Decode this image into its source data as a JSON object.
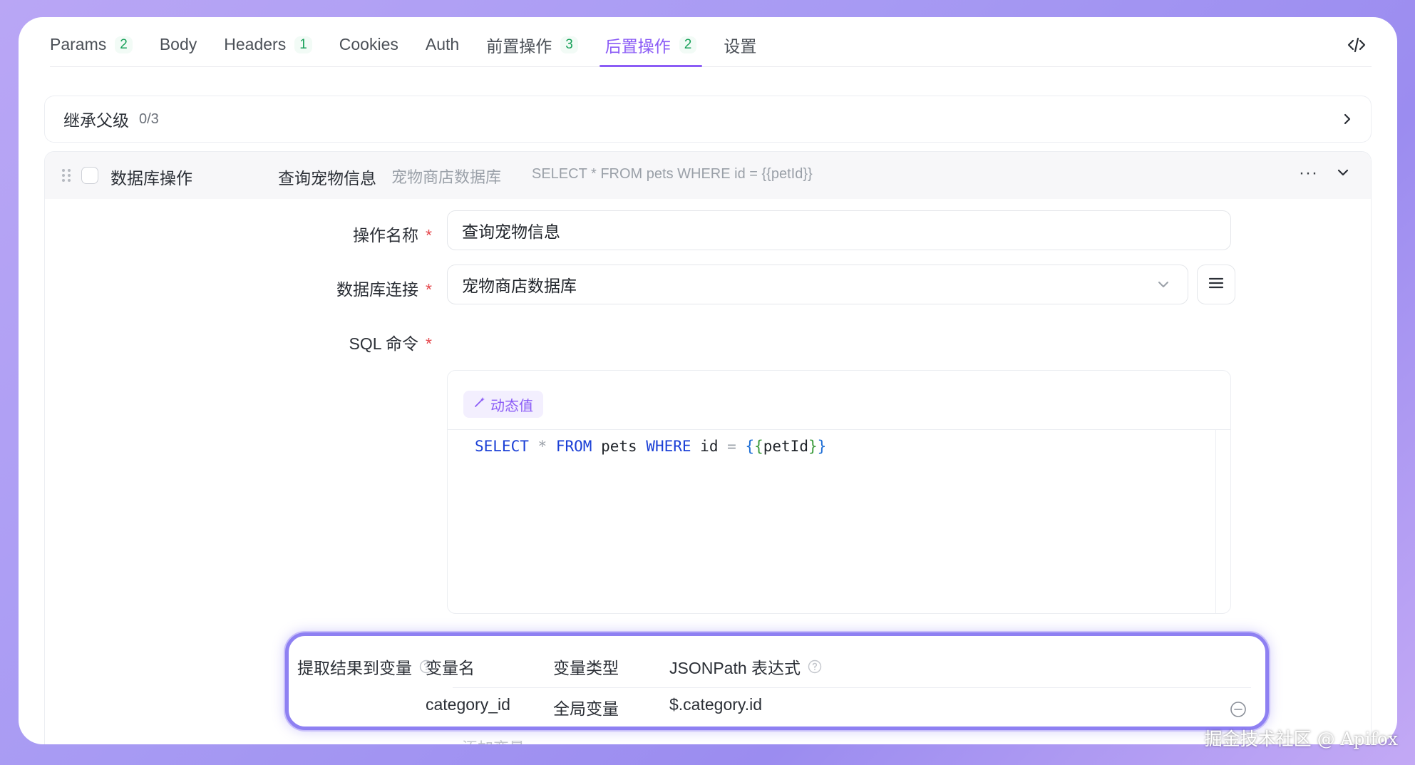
{
  "tabs": [
    {
      "label": "Params",
      "badge": "2"
    },
    {
      "label": "Body",
      "badge": ""
    },
    {
      "label": "Headers",
      "badge": "1"
    },
    {
      "label": "Cookies",
      "badge": ""
    },
    {
      "label": "Auth",
      "badge": ""
    },
    {
      "label": "前置操作",
      "badge": "3"
    },
    {
      "label": "后置操作",
      "badge": "2"
    },
    {
      "label": "设置",
      "badge": ""
    }
  ],
  "active_tab": "后置操作",
  "inherit": {
    "label": "继承父级",
    "count": "0/3"
  },
  "operation": {
    "type": "数据库操作",
    "name": "查询宠物信息",
    "db": "宠物商店数据库",
    "sql_preview": "SELECT * FROM pets WHERE id = {{petId}}",
    "more": "···"
  },
  "form": {
    "name_label": "操作名称",
    "name_value": "查询宠物信息",
    "db_label": "数据库连接",
    "db_value": "宠物商店数据库",
    "sql_label": "SQL 命令",
    "dynamic_value_btn": "动态值",
    "sql_tokens": {
      "select": "SELECT",
      "star": "*",
      "from": "FROM",
      "table": "pets",
      "where": "WHERE",
      "field": "id",
      "eq": "=",
      "var": "petId"
    },
    "required_mark": "*"
  },
  "extract": {
    "title": "提取结果到变量",
    "col_name": "变量名",
    "col_type": "变量类型",
    "col_jsonpath": "JSONPath 表达式",
    "rows": [
      {
        "name": "category_id",
        "type": "全局变量",
        "jsonpath": "$.category.id"
      }
    ],
    "add_label": "添加变量"
  },
  "resize_handle": "···",
  "watermark": "掘金技术社区 @ Apifox",
  "colors": {
    "accent": "#8b5cf6",
    "badge": "#19a15a",
    "required": "#e5484d",
    "sql_keyword": "#1a3fd6"
  }
}
